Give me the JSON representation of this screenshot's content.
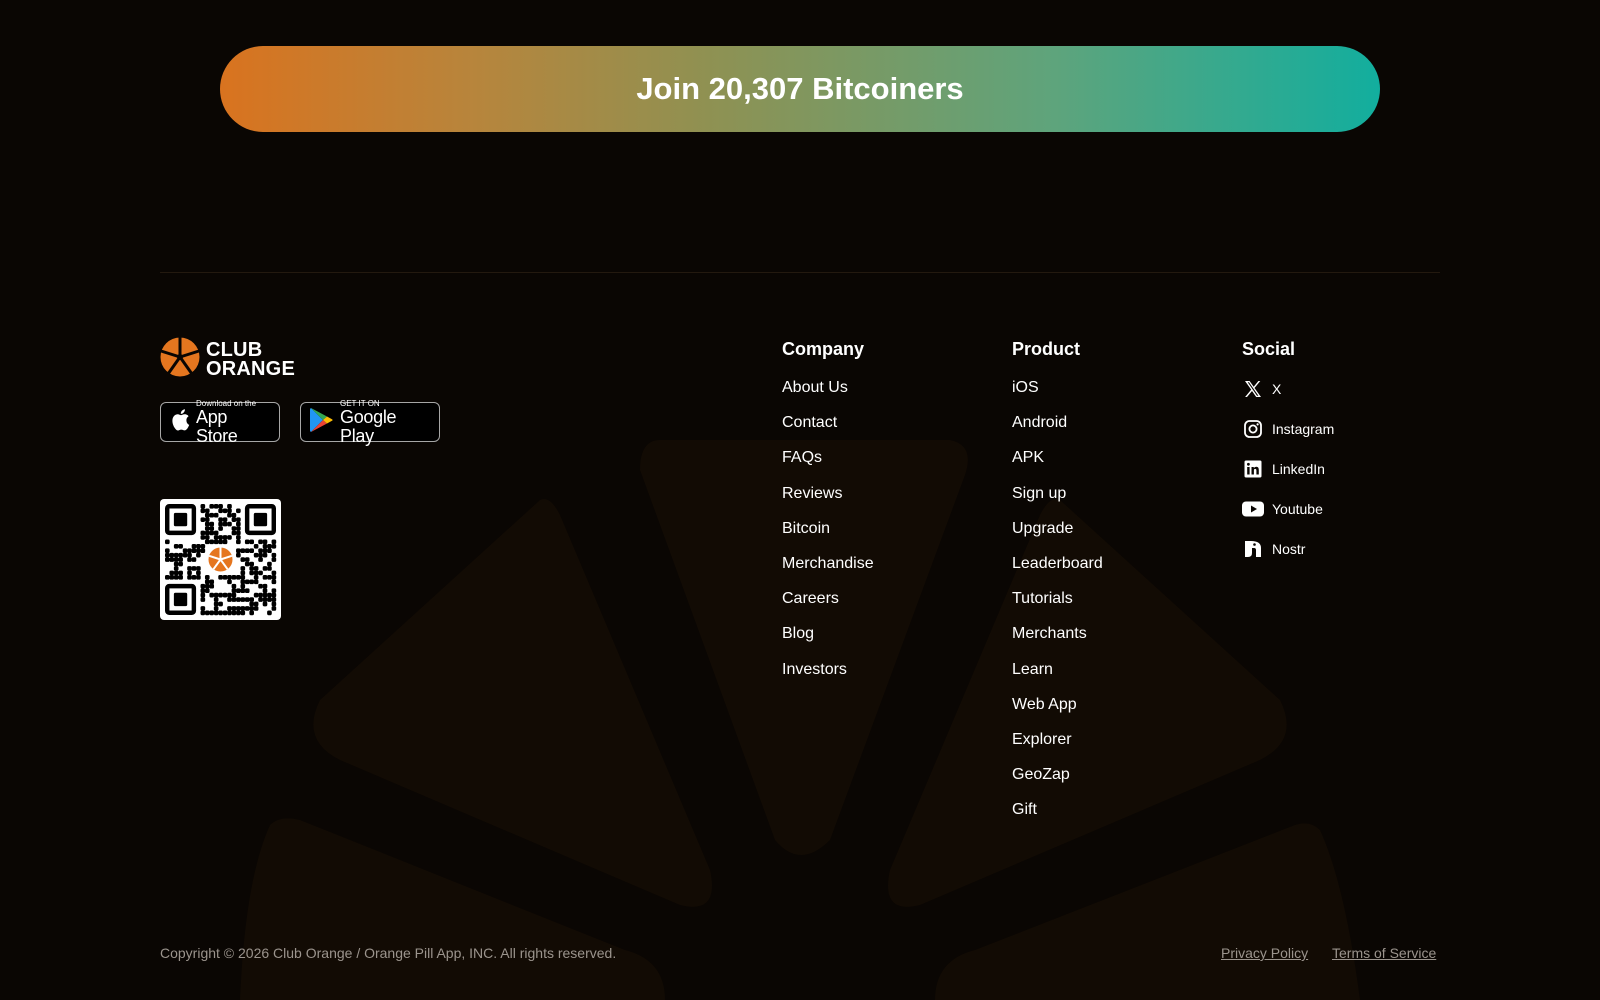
{
  "cta": {
    "label": "Join 20,307 Bitcoiners"
  },
  "brand": {
    "line1": "CLUB",
    "line2": "ORANGE",
    "orange": "#e5761f"
  },
  "stores": {
    "apple": {
      "small": "Download on the",
      "big": "App Store"
    },
    "google": {
      "small": "GET IT ON",
      "big": "Google Play"
    }
  },
  "columns": {
    "company": {
      "title": "Company",
      "items": [
        "About Us",
        "Contact",
        "FAQs",
        "Reviews",
        "Bitcoin",
        "Merchandise",
        "Careers",
        "Blog",
        "Investors"
      ]
    },
    "product": {
      "title": "Product",
      "items": [
        "iOS",
        "Android",
        "APK",
        "Sign up",
        "Upgrade",
        "Leaderboard",
        "Tutorials",
        "Merchants",
        "Learn",
        "Web App",
        "Explorer",
        "GeoZap",
        "Gift"
      ]
    },
    "social": {
      "title": "Social",
      "items": [
        {
          "label": "X",
          "icon": "x-icon"
        },
        {
          "label": "Instagram",
          "icon": "instagram-icon"
        },
        {
          "label": "LinkedIn",
          "icon": "linkedin-icon"
        },
        {
          "label": "Youtube",
          "icon": "youtube-icon"
        },
        {
          "label": "Nostr",
          "icon": "nostr-icon"
        }
      ]
    }
  },
  "footer": {
    "copyright": "Copyright © 2026 Club Orange / Orange Pill App, INC. All rights reserved.",
    "privacy": "Privacy Policy",
    "terms": "Terms of Service"
  }
}
